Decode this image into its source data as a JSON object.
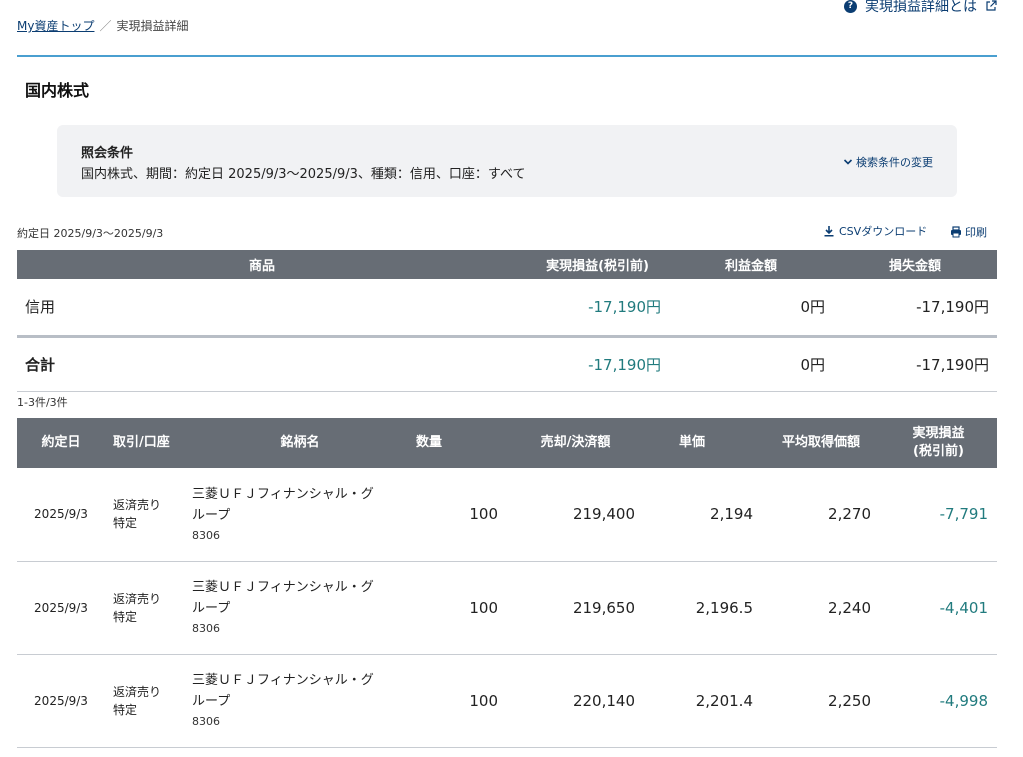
{
  "help": {
    "label": "実現損益詳細とは",
    "icon": "question-icon"
  },
  "breadcrumb": {
    "home": "My資産トップ",
    "separator": "／",
    "current": "実現損益詳細"
  },
  "section": {
    "title": "国内株式"
  },
  "conditions": {
    "label": "照会条件",
    "text": "国内株式、期間：約定日 2025/9/3〜2025/9/3、種類：信用、口座：すべて",
    "change_label": "検索条件の変更"
  },
  "toolbar": {
    "date_range": "約定日 2025/9/3〜2025/9/3",
    "csv_label": "CSVダウンロード",
    "print_label": "印刷"
  },
  "summary": {
    "headers": [
      "商品",
      "実現損益(税引前)",
      "利益金額",
      "損失金額"
    ],
    "rows": [
      {
        "product": "信用",
        "realized": "-17,190円",
        "profit": "0円",
        "loss": "-17,190円"
      },
      {
        "product": "合計",
        "realized": "-17,190円",
        "profit": "0円",
        "loss": "-17,190円"
      }
    ]
  },
  "count": "1-3件/3件",
  "detail": {
    "headers": {
      "date": "約定日",
      "trade": "取引/口座",
      "name": "銘柄名",
      "qty": "数量",
      "amount": "売却/決済額",
      "unit": "単価",
      "avg": "平均取得価額",
      "pl_line1": "実現損益",
      "pl_line2": "(税引前)"
    },
    "rows": [
      {
        "date": "2025/9/3",
        "trade": "返済売り",
        "account": "特定",
        "name_line1": "三菱ＵＦＪフィナンシャル・グ",
        "name_line2": "ループ",
        "code": "8306",
        "qty": "100",
        "amount": "219,400",
        "unit": "2,194",
        "avg": "2,270",
        "pl": "-7,791"
      },
      {
        "date": "2025/9/3",
        "trade": "返済売り",
        "account": "特定",
        "name_line1": "三菱ＵＦＪフィナンシャル・グ",
        "name_line2": "ループ",
        "code": "8306",
        "qty": "100",
        "amount": "219,650",
        "unit": "2,196.5",
        "avg": "2,240",
        "pl": "-4,401"
      },
      {
        "date": "2025/9/3",
        "trade": "返済売り",
        "account": "特定",
        "name_line1": "三菱ＵＦＪフィナンシャル・グ",
        "name_line2": "ループ",
        "code": "8306",
        "qty": "100",
        "amount": "220,140",
        "unit": "2,201.4",
        "avg": "2,250",
        "pl": "-4,998"
      }
    ]
  },
  "colors": {
    "accent_rule": "#4a9fd0",
    "header_bg": "#676d75",
    "link": "#0b3d72",
    "negative": "#217b7e"
  }
}
